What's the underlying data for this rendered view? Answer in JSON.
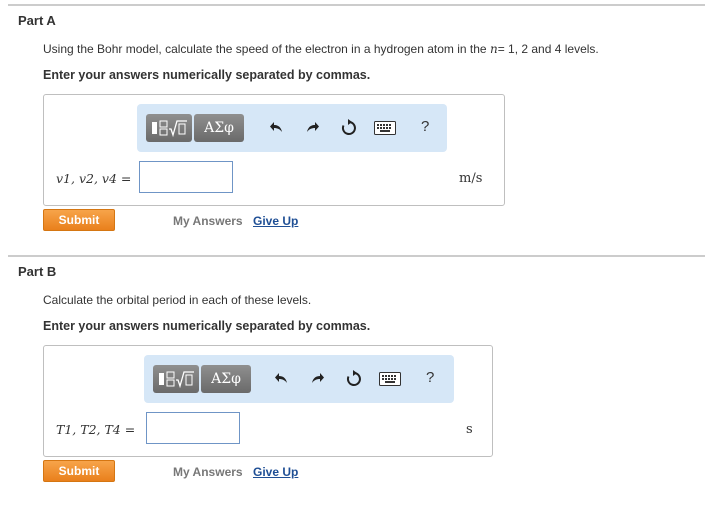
{
  "part_a": {
    "title": "Part A",
    "prompt_before": "Using the Bohr model, calculate the speed of the electron in a hydrogen atom in the ",
    "prompt_var": "n",
    "prompt_after": "= 1, 2 and 4 levels.",
    "instruction": "Enter your answers numerically separated by commas.",
    "variable_label": "v1, v2, v4 =",
    "input_value": "",
    "unit": "m/s",
    "submit_label": "Submit",
    "my_answers_label": "My Answers",
    "give_up_label": "Give Up"
  },
  "part_b": {
    "title": "Part B",
    "prompt": "Calculate the orbital period in each of these levels.",
    "instruction": "Enter your answers numerically separated by commas.",
    "variable_label": "T1, T2, T4 =",
    "input_value": "",
    "unit": "s",
    "submit_label": "Submit",
    "my_answers_label": "My Answers",
    "give_up_label": "Give Up"
  },
  "toolbar": {
    "templates_icon": "radical-template-icon",
    "symbols_label": "ΑΣφ",
    "undo_icon": "undo-icon",
    "redo_icon": "redo-icon",
    "reset_icon": "reset-icon",
    "keyboard_icon": "keyboard-icon",
    "help_label": "?"
  },
  "colors": {
    "toolbar_bg": "#d6e7f7",
    "submit_bg": "#f0901f",
    "link": "#1f4f95",
    "input_border": "#6f95c6"
  }
}
